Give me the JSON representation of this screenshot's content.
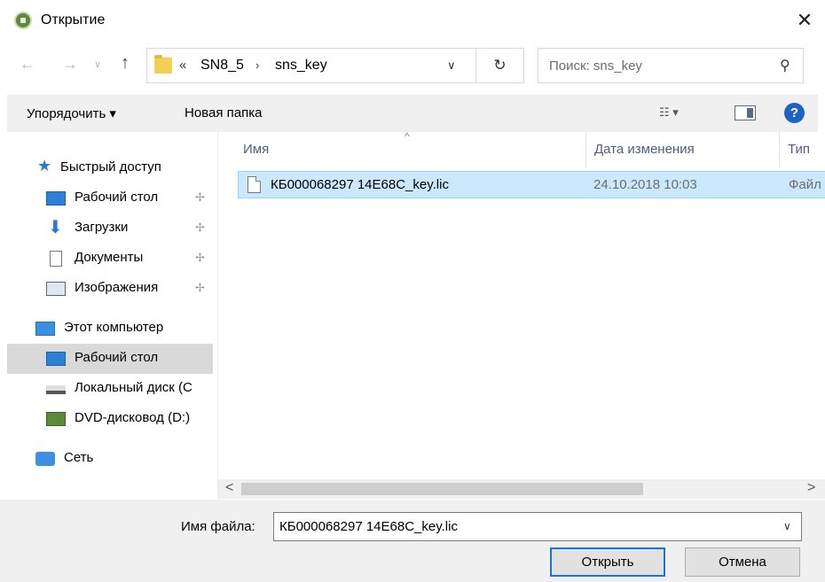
{
  "window": {
    "title": "Открытие",
    "close_glyph": "✕",
    "app_icon": "app-icon"
  },
  "nav": {
    "back_glyph": "←",
    "forward_glyph": "→",
    "recent_glyph": "∨",
    "up_glyph": "↑",
    "breadcrumb_overflow": "«",
    "breadcrumbs": [
      "SN8_5",
      "sns_key"
    ],
    "breadcrumb_separator": "›",
    "dropdown_glyph": "∨",
    "refresh_glyph": "↻"
  },
  "search": {
    "placeholder": "Поиск: sns_key",
    "icon": "⚲"
  },
  "toolbar": {
    "organize_label": "Упорядочить ▾",
    "new_folder_label": "Новая папка",
    "view_label": "☷ ▾",
    "help_label": "?"
  },
  "sidebar": {
    "items": [
      {
        "label": "Быстрый доступ",
        "icon": "star-icon"
      },
      {
        "label": "Рабочий стол",
        "icon": "desktop-icon",
        "pinned": true
      },
      {
        "label": "Загрузки",
        "icon": "download-icon",
        "pinned": true
      },
      {
        "label": "Документы",
        "icon": "document-icon",
        "pinned": true
      },
      {
        "label": "Изображения",
        "icon": "pictures-icon",
        "pinned": true
      },
      {
        "label": "Этот компьютер",
        "icon": "computer-icon"
      },
      {
        "label": "Рабочий стол",
        "icon": "desktop-icon",
        "selected": true
      },
      {
        "label": "Локальный диск (C",
        "icon": "disk-icon"
      },
      {
        "label": "DVD-дисковод (D:)",
        "icon": "dvd-icon"
      },
      {
        "label": "Сеть",
        "icon": "network-icon"
      }
    ],
    "pin_glyph": "📌"
  },
  "file_list": {
    "columns": [
      "Имя",
      "Дата изменения",
      "Тип"
    ],
    "sort_glyph": "^",
    "rows": [
      {
        "name": "КБ000068297 14E68C_key.lic",
        "date": "24.10.2018 10:03",
        "type": "Файл"
      }
    ]
  },
  "scrollbar": {
    "left_glyph": "<",
    "right_glyph": ">"
  },
  "footer": {
    "filename_label": "Имя файла:",
    "filename_value": "КБ000068297 14E68C_key.lic",
    "dropdown_glyph": "∨",
    "open_label": "Открыть",
    "cancel_label": "Отмена"
  },
  "colors": {
    "selection_bg": "#cce8ff",
    "selection_border": "#99d1ff",
    "toolbar_bg": "#f0f0f0",
    "accent": "#1a73d9"
  }
}
